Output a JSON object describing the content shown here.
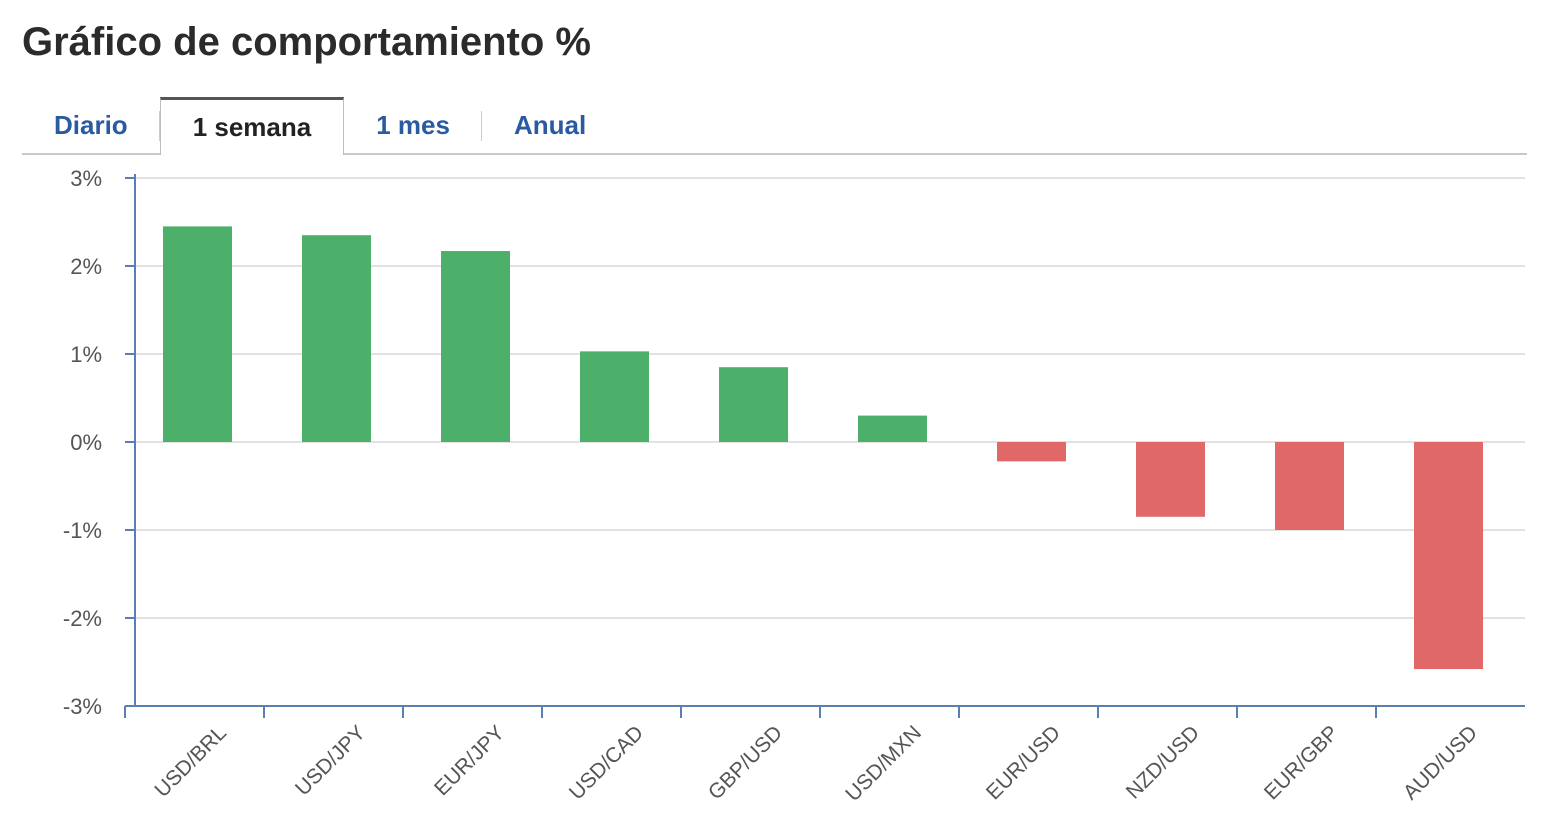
{
  "title": "Gráfico de comportamiento %",
  "tabs": [
    {
      "label": "Diario",
      "active": false
    },
    {
      "label": "1 semana",
      "active": true
    },
    {
      "label": "1 mes",
      "active": false
    },
    {
      "label": "Anual",
      "active": false
    }
  ],
  "colors": {
    "positive": "#4caf6a",
    "negative": "#e06868",
    "axis": "#5a7fb5",
    "grid": "#e2e2e2"
  },
  "chart_data": {
    "type": "bar",
    "categories": [
      "USD/BRL",
      "USD/JPY",
      "EUR/JPY",
      "USD/CAD",
      "GBP/USD",
      "USD/MXN",
      "EUR/USD",
      "NZD/USD",
      "EUR/GBP",
      "AUD/USD"
    ],
    "values": [
      2.45,
      2.35,
      2.17,
      1.03,
      0.85,
      0.3,
      -0.22,
      -0.85,
      -1.0,
      -2.58
    ],
    "y_ticks": [
      "3%",
      "2%",
      "1%",
      "0%",
      "-1%",
      "-2%",
      "-3%"
    ],
    "ylim": [
      -3,
      3
    ],
    "grid": true,
    "legend": "none"
  }
}
